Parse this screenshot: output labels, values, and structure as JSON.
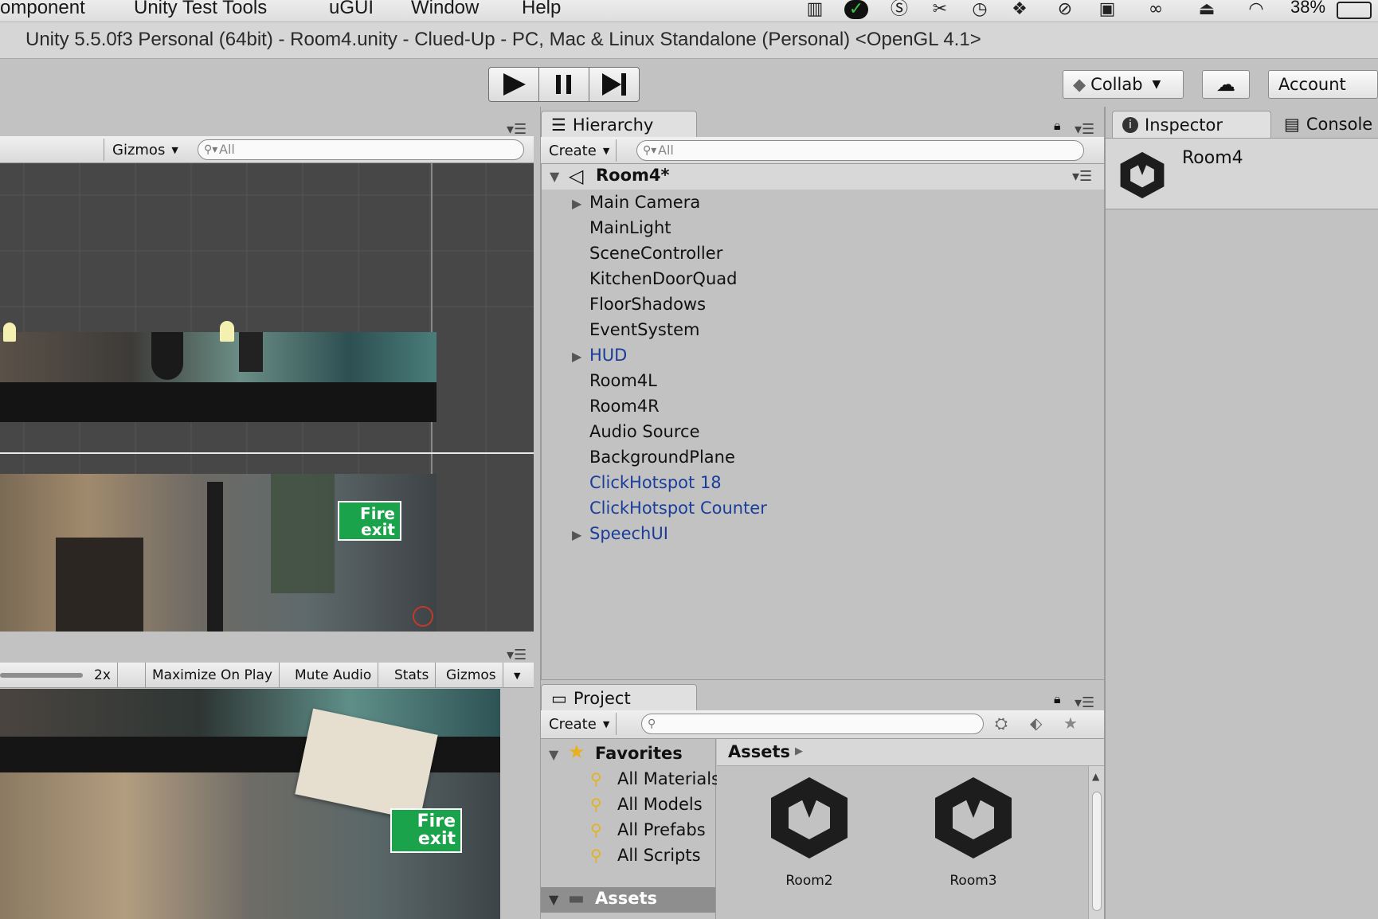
{
  "menubar": {
    "items": [
      "omponent",
      "Unity Test Tools",
      "uGUI",
      "Window",
      "Help"
    ],
    "battery": "38%"
  },
  "window": {
    "title": "Unity 5.5.0f3 Personal (64bit) - Room4.unity - Clued-Up - PC, Mac & Linux Standalone (Personal) <OpenGL 4.1>"
  },
  "toolbar": {
    "collab_label": "Collab",
    "account_label": "Account"
  },
  "scene_view": {
    "gizmos_label": "Gizmos",
    "search_placeholder": "All",
    "fire_exit_top": "Fire",
    "fire_exit_bottom": "exit"
  },
  "game_view": {
    "scale_label": "2x",
    "buttons": [
      "Maximize On Play",
      "Mute Audio",
      "Stats",
      "Gizmos"
    ]
  },
  "hierarchy": {
    "tab_label": "Hierarchy",
    "create_label": "Create",
    "search_placeholder": "All",
    "scene_name": "Room4*",
    "items": [
      {
        "label": "Main Camera",
        "expandable": true,
        "prefab": false
      },
      {
        "label": "MainLight",
        "expandable": false,
        "prefab": false
      },
      {
        "label": "SceneController",
        "expandable": false,
        "prefab": false
      },
      {
        "label": "KitchenDoorQuad",
        "expandable": false,
        "prefab": false
      },
      {
        "label": "FloorShadows",
        "expandable": false,
        "prefab": false
      },
      {
        "label": "EventSystem",
        "expandable": false,
        "prefab": false
      },
      {
        "label": "HUD",
        "expandable": true,
        "prefab": true
      },
      {
        "label": "Room4L",
        "expandable": false,
        "prefab": false
      },
      {
        "label": "Room4R",
        "expandable": false,
        "prefab": false
      },
      {
        "label": "Audio Source",
        "expandable": false,
        "prefab": false
      },
      {
        "label": "BackgroundPlane",
        "expandable": false,
        "prefab": false
      },
      {
        "label": "ClickHotspot 18",
        "expandable": false,
        "prefab": true
      },
      {
        "label": "ClickHotspot Counter",
        "expandable": false,
        "prefab": true
      },
      {
        "label": "SpeechUI",
        "expandable": true,
        "prefab": true
      }
    ]
  },
  "inspector": {
    "tab_label": "Inspector",
    "console_tab_label": "Console",
    "object_name": "Room4"
  },
  "project": {
    "tab_label": "Project",
    "create_label": "Create",
    "favorites_label": "Favorites",
    "favorites": [
      "All Materials",
      "All Models",
      "All Prefabs",
      "All Scripts"
    ],
    "assets_folder_label": "Assets",
    "breadcrumb": "Assets",
    "assets": [
      "Room2",
      "Room3"
    ]
  },
  "colors": {
    "prefab_text": "#1a3d9a",
    "panel_bg": "#c2c2c2",
    "scene_bg": "#474747"
  }
}
